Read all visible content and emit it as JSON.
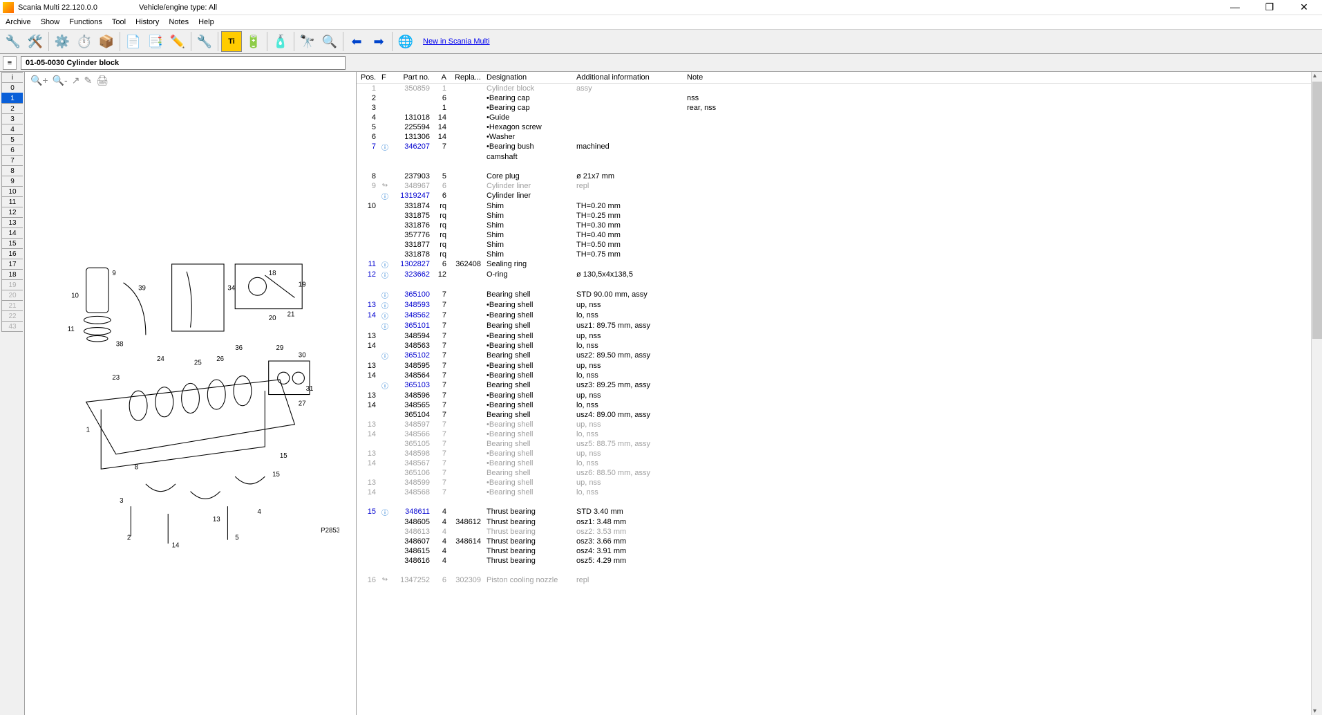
{
  "titlebar": {
    "app": "Scania Multi  22.120.0.0",
    "vehicle": "Vehicle/engine type: All"
  },
  "menus": [
    "Archive",
    "Show",
    "Functions",
    "Tool",
    "History",
    "Notes",
    "Help"
  ],
  "toolbar_link": "New in Scania Multi",
  "path": "01-05-0030 Cylinder block",
  "tabs": [
    "i",
    "0",
    "1",
    "2",
    "3",
    "4",
    "5",
    "6",
    "7",
    "8",
    "9",
    "10",
    "11",
    "12",
    "13",
    "14",
    "15",
    "16",
    "17",
    "18",
    "19",
    "20",
    "21",
    "22",
    "43"
  ],
  "active_tab": 2,
  "disabled_tabs": [
    20,
    21,
    22,
    23,
    24
  ],
  "columns": [
    "Pos.",
    "F",
    "Part no.",
    "A",
    "Repla...",
    "Designation",
    "Additional information",
    "Note"
  ],
  "rows": [
    {
      "pos": "1",
      "f": "",
      "part": "350859",
      "a": "1",
      "repl": "",
      "desig": "Cylinder block",
      "add": "assy",
      "note": "",
      "muted": true
    },
    {
      "pos": "2",
      "f": "",
      "part": "",
      "a": "6",
      "repl": "",
      "desig": "•Bearing cap",
      "add": "",
      "note": "nss"
    },
    {
      "pos": "3",
      "f": "",
      "part": "",
      "a": "1",
      "repl": "",
      "desig": "•Bearing cap",
      "add": "",
      "note": "rear, nss"
    },
    {
      "pos": "4",
      "f": "",
      "part": "131018",
      "a": "14",
      "repl": "",
      "desig": "•Guide",
      "add": "",
      "note": ""
    },
    {
      "pos": "5",
      "f": "",
      "part": "225594",
      "a": "14",
      "repl": "",
      "desig": "•Hexagon screw",
      "add": "",
      "note": ""
    },
    {
      "pos": "6",
      "f": "",
      "part": "131306",
      "a": "14",
      "repl": "",
      "desig": "•Washer",
      "add": "",
      "note": ""
    },
    {
      "pos": "7",
      "f": "ⓘ",
      "part": "346207",
      "a": "7",
      "repl": "",
      "desig": "•Bearing bush",
      "add": "machined",
      "note": "",
      "blue": true
    },
    {
      "pos": "",
      "f": "",
      "part": "",
      "a": "",
      "repl": "",
      "desig": "camshaft",
      "add": "",
      "note": ""
    },
    {
      "pos": "",
      "f": "",
      "part": "",
      "a": "",
      "repl": "",
      "desig": "",
      "add": "",
      "note": ""
    },
    {
      "pos": "8",
      "f": "",
      "part": "237903",
      "a": "5",
      "repl": "",
      "desig": "Core plug",
      "add": "ø 21x7 mm",
      "note": ""
    },
    {
      "pos": "9",
      "f": "↬",
      "part": "348967",
      "a": "6",
      "repl": "",
      "desig": "Cylinder liner",
      "add": "repl",
      "note": "",
      "muted": true
    },
    {
      "pos": "",
      "f": "ⓘ",
      "part": "1319247",
      "a": "6",
      "repl": "",
      "desig": "Cylinder liner",
      "add": "",
      "note": "",
      "blue": true
    },
    {
      "pos": "10",
      "f": "",
      "part": "331874",
      "a": "rq",
      "repl": "",
      "desig": "Shim",
      "add": "TH=0.20 mm",
      "note": ""
    },
    {
      "pos": "",
      "f": "",
      "part": "331875",
      "a": "rq",
      "repl": "",
      "desig": "Shim",
      "add": "TH=0.25 mm",
      "note": ""
    },
    {
      "pos": "",
      "f": "",
      "part": "331876",
      "a": "rq",
      "repl": "",
      "desig": "Shim",
      "add": "TH=0.30 mm",
      "note": ""
    },
    {
      "pos": "",
      "f": "",
      "part": "357776",
      "a": "rq",
      "repl": "",
      "desig": "Shim",
      "add": "TH=0.40 mm",
      "note": ""
    },
    {
      "pos": "",
      "f": "",
      "part": "331877",
      "a": "rq",
      "repl": "",
      "desig": "Shim",
      "add": "TH=0.50 mm",
      "note": ""
    },
    {
      "pos": "",
      "f": "",
      "part": "331878",
      "a": "rq",
      "repl": "",
      "desig": "Shim",
      "add": "TH=0.75 mm",
      "note": ""
    },
    {
      "pos": "11",
      "f": "ⓘ",
      "part": "1302827",
      "a": "6",
      "repl": "362408",
      "desig": "Sealing ring",
      "add": "",
      "note": "",
      "blue": true
    },
    {
      "pos": "12",
      "f": "ⓘ",
      "part": "323662",
      "a": "12",
      "repl": "",
      "desig": "O-ring",
      "add": "ø 130,5x4x138,5",
      "note": "",
      "blue": true
    },
    {
      "pos": "",
      "f": "",
      "part": "",
      "a": "",
      "repl": "",
      "desig": "",
      "add": "",
      "note": ""
    },
    {
      "pos": "",
      "f": "ⓘ",
      "part": "365100",
      "a": "7",
      "repl": "",
      "desig": "Bearing shell",
      "add": "STD 90.00 mm, assy",
      "note": "",
      "blue": true
    },
    {
      "pos": "13",
      "f": "ⓘ",
      "part": "348593",
      "a": "7",
      "repl": "",
      "desig": "•Bearing shell",
      "add": "up, nss",
      "note": "",
      "blue": true
    },
    {
      "pos": "14",
      "f": "ⓘ",
      "part": "348562",
      "a": "7",
      "repl": "",
      "desig": "•Bearing shell",
      "add": "lo, nss",
      "note": "",
      "blue": true
    },
    {
      "pos": "",
      "f": "ⓘ",
      "part": "365101",
      "a": "7",
      "repl": "",
      "desig": "Bearing shell",
      "add": "usz1: 89.75 mm, assy",
      "note": "",
      "blue": true
    },
    {
      "pos": "13",
      "f": "",
      "part": "348594",
      "a": "7",
      "repl": "",
      "desig": "•Bearing shell",
      "add": "up, nss",
      "note": ""
    },
    {
      "pos": "14",
      "f": "",
      "part": "348563",
      "a": "7",
      "repl": "",
      "desig": "•Bearing shell",
      "add": "lo, nss",
      "note": ""
    },
    {
      "pos": "",
      "f": "ⓘ",
      "part": "365102",
      "a": "7",
      "repl": "",
      "desig": "Bearing shell",
      "add": "usz2: 89.50 mm, assy",
      "note": "",
      "blue": true
    },
    {
      "pos": "13",
      "f": "",
      "part": "348595",
      "a": "7",
      "repl": "",
      "desig": "•Bearing shell",
      "add": "up, nss",
      "note": ""
    },
    {
      "pos": "14",
      "f": "",
      "part": "348564",
      "a": "7",
      "repl": "",
      "desig": "•Bearing shell",
      "add": "lo, nss",
      "note": ""
    },
    {
      "pos": "",
      "f": "ⓘ",
      "part": "365103",
      "a": "7",
      "repl": "",
      "desig": "Bearing shell",
      "add": "usz3: 89.25 mm, assy",
      "note": "",
      "blue": true
    },
    {
      "pos": "13",
      "f": "",
      "part": "348596",
      "a": "7",
      "repl": "",
      "desig": "•Bearing shell",
      "add": "up, nss",
      "note": ""
    },
    {
      "pos": "14",
      "f": "",
      "part": "348565",
      "a": "7",
      "repl": "",
      "desig": "•Bearing shell",
      "add": "lo, nss",
      "note": ""
    },
    {
      "pos": "",
      "f": "",
      "part": "365104",
      "a": "7",
      "repl": "",
      "desig": "Bearing shell",
      "add": "usz4: 89.00 mm, assy",
      "note": ""
    },
    {
      "pos": "13",
      "f": "",
      "part": "348597",
      "a": "7",
      "repl": "",
      "desig": "•Bearing shell",
      "add": "up, nss",
      "note": "",
      "muted": true
    },
    {
      "pos": "14",
      "f": "",
      "part": "348566",
      "a": "7",
      "repl": "",
      "desig": "•Bearing shell",
      "add": "lo, nss",
      "note": "",
      "muted": true
    },
    {
      "pos": "",
      "f": "",
      "part": "365105",
      "a": "7",
      "repl": "",
      "desig": "Bearing shell",
      "add": "usz5: 88.75 mm, assy",
      "note": "",
      "muted": true
    },
    {
      "pos": "13",
      "f": "",
      "part": "348598",
      "a": "7",
      "repl": "",
      "desig": "•Bearing shell",
      "add": "up, nss",
      "note": "",
      "muted": true
    },
    {
      "pos": "14",
      "f": "",
      "part": "348567",
      "a": "7",
      "repl": "",
      "desig": "•Bearing shell",
      "add": "lo, nss",
      "note": "",
      "muted": true
    },
    {
      "pos": "",
      "f": "",
      "part": "365106",
      "a": "7",
      "repl": "",
      "desig": "Bearing shell",
      "add": "usz6: 88.50 mm, assy",
      "note": "",
      "muted": true
    },
    {
      "pos": "13",
      "f": "",
      "part": "348599",
      "a": "7",
      "repl": "",
      "desig": "•Bearing shell",
      "add": "up, nss",
      "note": "",
      "muted": true
    },
    {
      "pos": "14",
      "f": "",
      "part": "348568",
      "a": "7",
      "repl": "",
      "desig": "•Bearing shell",
      "add": "lo, nss",
      "note": "",
      "muted": true
    },
    {
      "pos": "",
      "f": "",
      "part": "",
      "a": "",
      "repl": "",
      "desig": "",
      "add": "",
      "note": ""
    },
    {
      "pos": "15",
      "f": "ⓘ",
      "part": "348611",
      "a": "4",
      "repl": "",
      "desig": "Thrust bearing",
      "add": "STD 3.40 mm",
      "note": "",
      "blue": true
    },
    {
      "pos": "",
      "f": "",
      "part": "348605",
      "a": "4",
      "repl": "348612",
      "desig": "Thrust bearing",
      "add": "osz1: 3.48 mm",
      "note": ""
    },
    {
      "pos": "",
      "f": "",
      "part": "348613",
      "a": "4",
      "repl": "",
      "desig": "Thrust bearing",
      "add": "osz2: 3.53 mm",
      "note": "",
      "muted": true
    },
    {
      "pos": "",
      "f": "",
      "part": "348607",
      "a": "4",
      "repl": "348614",
      "desig": "Thrust bearing",
      "add": "osz3: 3.66 mm",
      "note": ""
    },
    {
      "pos": "",
      "f": "",
      "part": "348615",
      "a": "4",
      "repl": "",
      "desig": "Thrust bearing",
      "add": "osz4: 3.91 mm",
      "note": ""
    },
    {
      "pos": "",
      "f": "",
      "part": "348616",
      "a": "4",
      "repl": "",
      "desig": "Thrust bearing",
      "add": "osz5: 4.29 mm",
      "note": ""
    },
    {
      "pos": "",
      "f": "",
      "part": "",
      "a": "",
      "repl": "",
      "desig": "",
      "add": "",
      "note": ""
    },
    {
      "pos": "16",
      "f": "↬",
      "part": "1347252",
      "a": "6",
      "repl": "302309",
      "desig": "Piston cooling nozzle",
      "add": "repl",
      "note": "",
      "muted": true
    }
  ]
}
